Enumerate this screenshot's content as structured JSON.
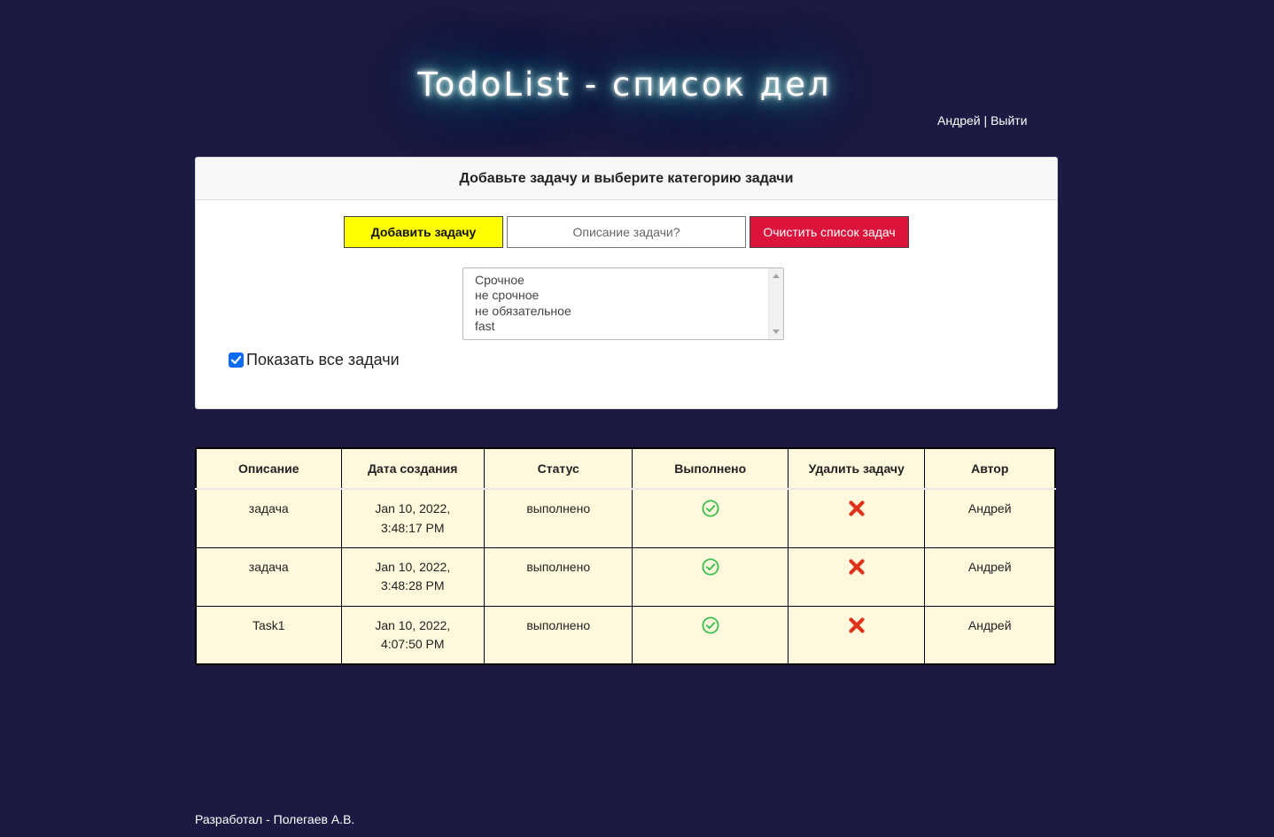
{
  "header": {
    "title": "TodoList - список дел",
    "user_name": "Андрей",
    "separator": " | ",
    "logout_label": "Выйти"
  },
  "panel": {
    "heading": "Добавьте задачу и выберите категорию задачи",
    "add_button_label": "Добавить задачу",
    "task_input": {
      "placeholder": "Описание задачи?",
      "value": ""
    },
    "clear_button_label": "Очистить список задач",
    "categories": [
      "Срочное",
      "не срочное",
      "не обязательное",
      "fast"
    ],
    "show_all": {
      "label": "Показать все задачи",
      "checked": true
    }
  },
  "table": {
    "columns": [
      "Описание",
      "Дата создания",
      "Статус",
      "Выполнено",
      "Удалить задачу",
      "Автор"
    ],
    "rows": [
      {
        "description": "задача",
        "date_line1": "Jan 10, 2022,",
        "date_line2": "3:48:17 PM",
        "status": "выполнено",
        "done_icon": "check-circle-icon",
        "delete_icon": "x-delete-icon",
        "author": "Андрей"
      },
      {
        "description": "задача",
        "date_line1": "Jan 10, 2022,",
        "date_line2": "3:48:28 PM",
        "status": "выполнено",
        "done_icon": "check-circle-icon",
        "delete_icon": "x-delete-icon",
        "author": "Андрей"
      },
      {
        "description": "Task1",
        "date_line1": "Jan 10, 2022,",
        "date_line2": "4:07:50 PM",
        "status": "выполнено",
        "done_icon": "check-circle-icon",
        "delete_icon": "x-delete-icon",
        "author": "Андрей"
      }
    ]
  },
  "footer": {
    "text": "Разработал - Полегаев А.В."
  },
  "colors": {
    "background": "#1b1a42",
    "add_button": "#ffff00",
    "clear_button": "#dc143c",
    "table_background": "#fff8dc",
    "check_icon": "#3cc04f",
    "delete_icon": "#e0311a",
    "checkbox": "#0b6cf0"
  }
}
